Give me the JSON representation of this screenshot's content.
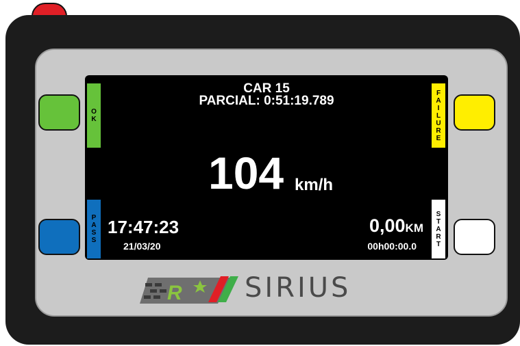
{
  "device": {
    "brand": "SIRIUS",
    "colors": {
      "led": "#e01f26",
      "ok": "#66c23a",
      "failure": "#ffee00",
      "pass": "#0f6fbd",
      "start": "#ffffff"
    }
  },
  "buttons": {
    "ok": {
      "label": "OK"
    },
    "pass": {
      "label": "PASS"
    },
    "failure": {
      "label": "FAILURE"
    },
    "start": {
      "label": "START"
    }
  },
  "screen": {
    "car": "CAR 15",
    "partial": "PARCIAL: 0:51:19.789",
    "speed": "104",
    "speed_unit": "km/h",
    "clock": "17:47:23",
    "date": "21/03/20",
    "distance": "0,00",
    "distance_unit": "KM",
    "elapsed": "00h00:00.0"
  }
}
